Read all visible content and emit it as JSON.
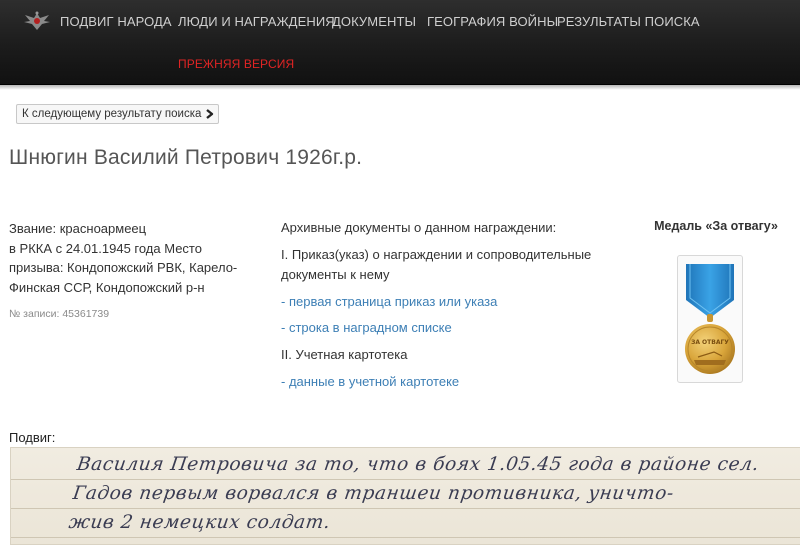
{
  "nav": {
    "items": [
      "Подвиг народа",
      "Люди и награждения",
      "Документы",
      "География войны",
      "Результаты поиска"
    ],
    "old_version": "Прежняя версия"
  },
  "next_result_label": "К следующему результату поиска",
  "person": {
    "title": "Шнюгин Василий Петрович 1926г.р.",
    "info_lines": [
      "Звание: красноармеец",
      "в РККА с 24.01.1945 года Место",
      "призыва: Кондопожский РВК, Карело-",
      "Финская ССР, Кондопожский р-н"
    ],
    "record_no": "№ записи: 45361739"
  },
  "docs": {
    "title": "Архивные документы о данном награждении:",
    "section1": "I. Приказ(указ) о награждении и сопроводительные документы к нему",
    "link_first_page": "- первая страница приказ или указа",
    "link_row": "- строка в наградном списке",
    "section2": "II. Учетная картотека",
    "link_card": "- данные в учетной картотеке"
  },
  "medal": {
    "name": "Медаль «За отвагу»",
    "inscription": "ЗА ОТВАГУ",
    "ribbon_color": "#2c8fd6",
    "medal_color": "#d9a53a"
  },
  "feat": {
    "label": "Подвиг:",
    "lines": [
      "Василия Петровича за то, что в боях 1.05.45 года в районе сел.",
      "Гадов первым ворвался в траншеи противника, уничто-",
      "жив 2 немецких солдат."
    ]
  },
  "colors": {
    "nav_bg": "#1c1c1c",
    "nav_text": "#cfcfcf",
    "old_version": "#e02424",
    "link": "#3d7fb5"
  }
}
